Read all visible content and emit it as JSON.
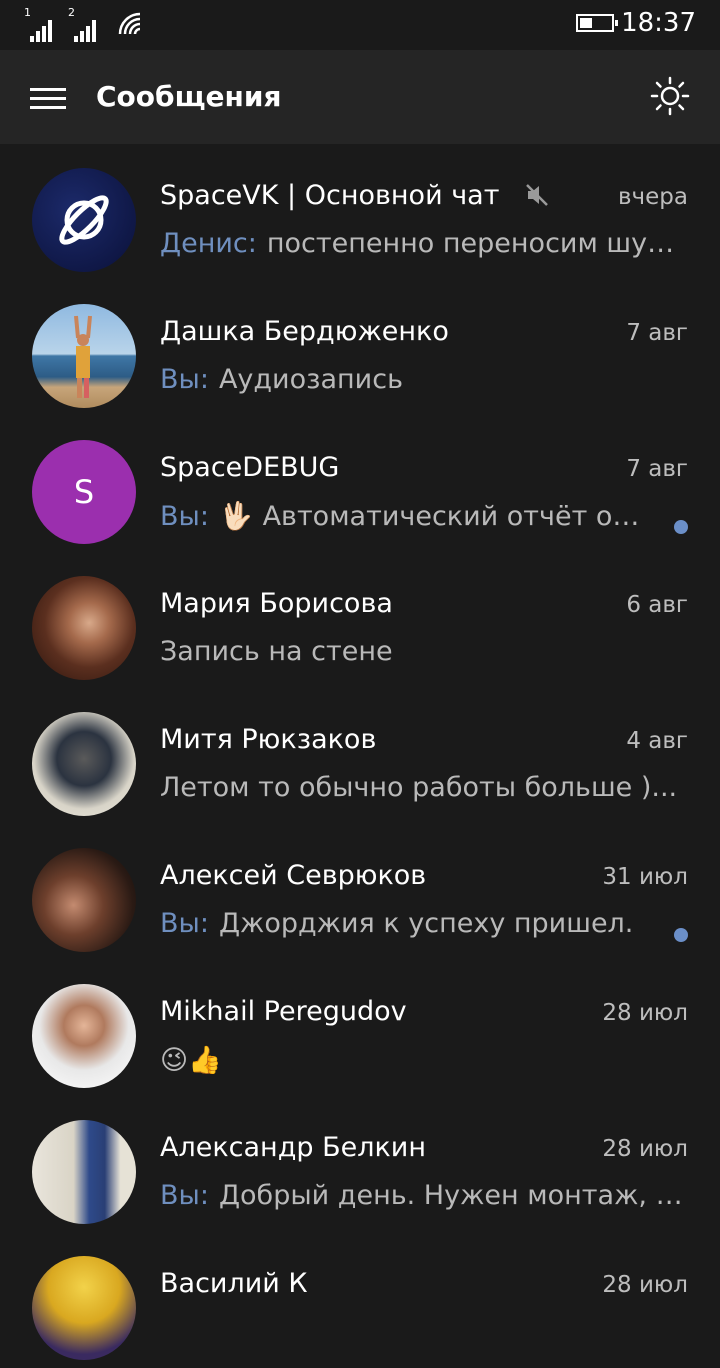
{
  "status_bar": {
    "time": "18:37",
    "sim1": "1",
    "sim2": "2"
  },
  "header": {
    "title": "Сообщения"
  },
  "conversations": [
    {
      "name": "SpaceVK | Основной чат",
      "date": "вчера",
      "sender": "Денис:",
      "preview": "постепенно переносим шутк...",
      "muted": true
    },
    {
      "name": "Дашка Бердюженко",
      "date": "7 авг",
      "sender": "Вы:",
      "preview": "Аудиозапись"
    },
    {
      "name": "SpaceDEBUG",
      "date": "7 авг",
      "sender": "Вы:",
      "emoji": "🖖🏻",
      "preview": "Автоматический отчёт об...",
      "unread": true,
      "avatar_letter": "S"
    },
    {
      "name": "Мария Борисова",
      "date": "6 авг",
      "preview": "Запись на стене"
    },
    {
      "name": "Митя Рюкзаков",
      "date": "4 авг",
      "preview": "Летом то обычно работы больше )..."
    },
    {
      "name": "Алексей Севрюков",
      "date": "31 июл",
      "sender": "Вы:",
      "preview": "Джорджия к успеху пришел.",
      "unread": true
    },
    {
      "name": "Mikhail Peregudov",
      "date": "28 июл",
      "preview": "😉👍"
    },
    {
      "name": "Александр Белкин",
      "date": "28 июл",
      "sender": "Вы:",
      "preview": "Добрый день. Нужен монтаж, ц..."
    },
    {
      "name": "Василий К",
      "date": "28 июл"
    }
  ]
}
